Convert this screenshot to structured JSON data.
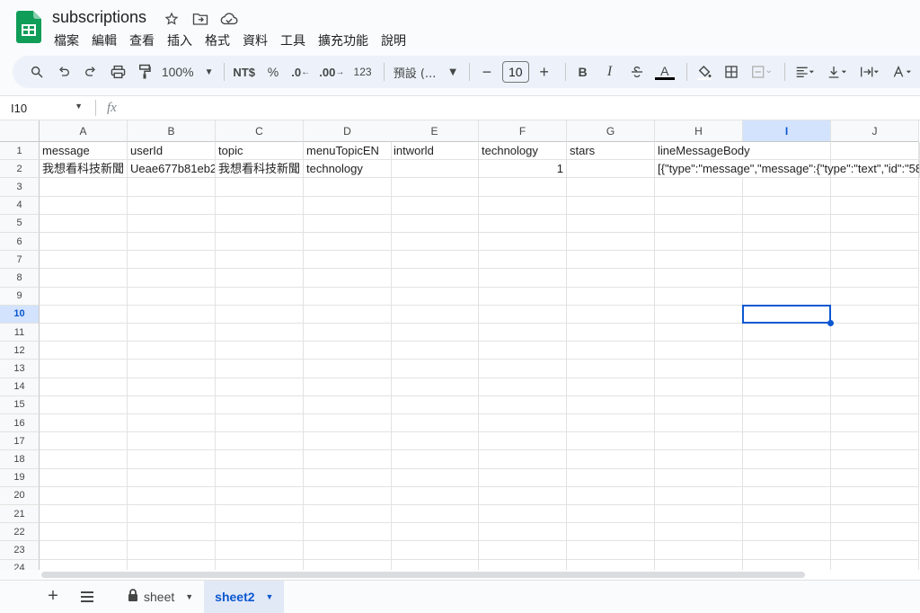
{
  "doc": {
    "title": "subscriptions"
  },
  "menu": [
    "檔案",
    "編輯",
    "查看",
    "插入",
    "格式",
    "資料",
    "工具",
    "擴充功能",
    "說明"
  ],
  "toolbar": {
    "zoom": "100%",
    "currency": "NT$",
    "percent": "%",
    "dec_less": ".0",
    "dec_more": ".00",
    "format_123": "123",
    "font": "預設 (...",
    "font_size": "10",
    "bold": "B",
    "italic": "I",
    "text_color": "A"
  },
  "formula": {
    "namebox": "I10",
    "fx": "fx",
    "content": ""
  },
  "columns": [
    "A",
    "B",
    "C",
    "D",
    "E",
    "F",
    "G",
    "H",
    "I",
    "J"
  ],
  "rows": [
    "1",
    "2",
    "3",
    "4",
    "5",
    "6",
    "7",
    "8",
    "9",
    "10",
    "11",
    "12",
    "13",
    "14",
    "15",
    "16",
    "17",
    "18",
    "19",
    "20",
    "21",
    "22",
    "23",
    "24"
  ],
  "cells": {
    "A1": "message",
    "B1": "userId",
    "C1": "topic",
    "D1": "menuTopicEN",
    "E1": "intworld",
    "F1": "technology",
    "G1": "stars",
    "H1": "lineMessageBody",
    "A2": "我想看科技新聞",
    "B2": "Ueae677b81eb2",
    "C2": "我想看科技新聞",
    "D2": "technology",
    "F2": "1",
    "H2": "[{\"type\":\"message\",\"message\":{\"type\":\"text\",\"id\":\"58"
  },
  "sheets": [
    {
      "name": "sheet",
      "locked": true
    },
    {
      "name": "sheet2",
      "active": true
    }
  ],
  "colors": {
    "accent": "#0b57d0",
    "sheets_green": "#0f9d58"
  }
}
